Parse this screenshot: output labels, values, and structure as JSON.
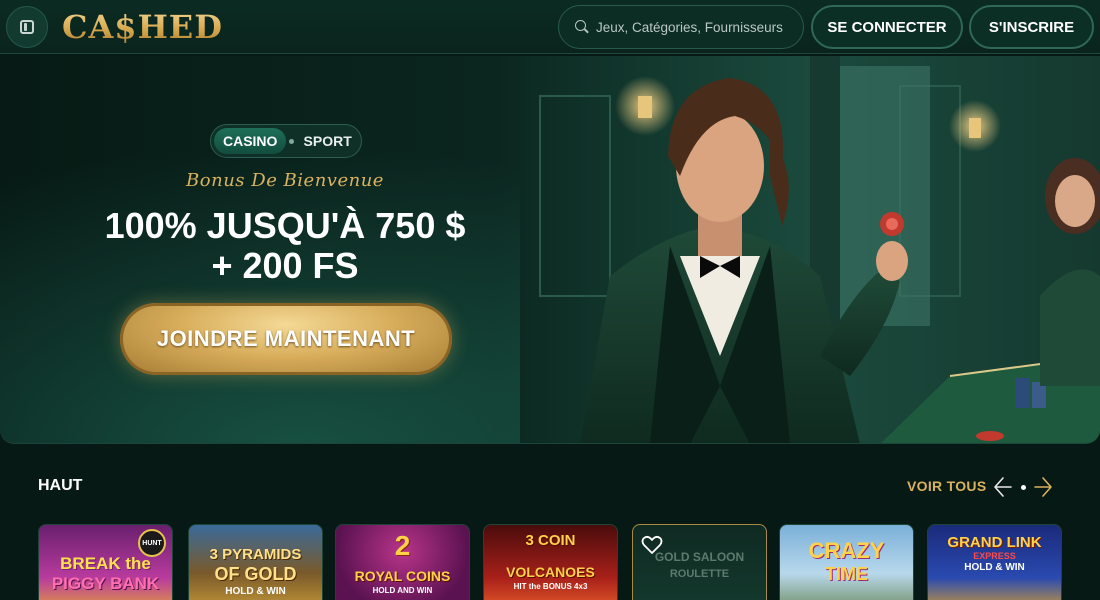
{
  "header": {
    "logo": "CA$HED",
    "search_placeholder": "Jeux, Catégories, Fournisseurs",
    "login_label": "SE CONNECTER",
    "signup_label": "S'INSCRIRE"
  },
  "hero": {
    "tabs": [
      "CASINO",
      "SPORT"
    ],
    "active_tab": "CASINO",
    "subtitle": "Bonus De Bienvenue",
    "headline_line1": "100% JUSQU'À 750 $",
    "headline_line2": "+ 200 FS",
    "cta_label": "JOINDRE MAINTENANT"
  },
  "games_section": {
    "title": "HAUT",
    "view_all_label": "VOIR TOUS",
    "games": [
      {
        "title_line1": "BREAK the",
        "title_line2": "PIGGY BANK",
        "badge": "HUNT"
      },
      {
        "title_line1": "3 PYRAMIDS",
        "title_line2": "OF GOLD",
        "title_line3": "HOLD & WIN"
      },
      {
        "title_line1": "2",
        "title_line2": "ROYAL COINS",
        "title_line3": "HOLD AND WIN"
      },
      {
        "title_line1": "3 COIN",
        "title_line2": "VOLCANOES",
        "title_line3": "HIT the BONUS 4x3"
      },
      {
        "title_line1": "GOLD SALOON",
        "title_line2": "ROULETTE"
      },
      {
        "title_line1": "CRAZY",
        "title_line2": "TIME"
      },
      {
        "title_line1": "GRAND LINK",
        "title_line2": "EXPRESS",
        "title_line3": "HOLD & WIN"
      }
    ]
  },
  "colors": {
    "background": "#071914",
    "accent_gold": "#d9b15f",
    "header_bg": "#0b2b22",
    "button_border": "#2f6857"
  },
  "icons": [
    "sidebar-toggle-icon",
    "search-icon",
    "chevron-left-icon",
    "chevron-right-icon",
    "heart-icon"
  ]
}
